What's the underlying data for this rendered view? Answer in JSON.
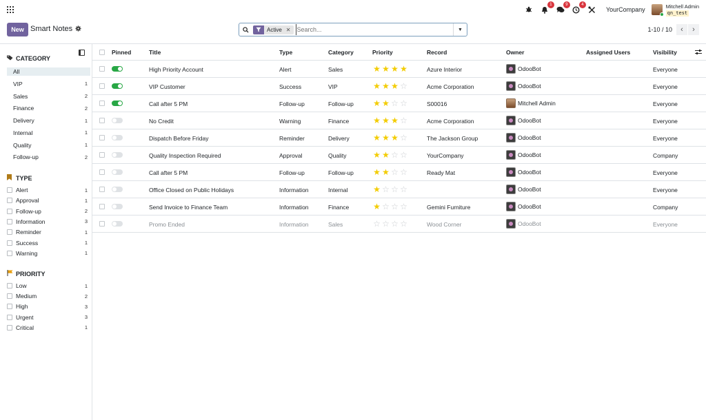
{
  "navbar": {
    "apps_icon": "apps-grid-icon",
    "icons": [
      {
        "name": "bug-icon",
        "glyph": "✹",
        "badge": ""
      },
      {
        "name": "bell-icon",
        "glyph": "🔔",
        "badge": "1"
      },
      {
        "name": "chat-icon",
        "glyph": "💬",
        "badge": "9"
      },
      {
        "name": "activity-clock-icon",
        "glyph": "◷",
        "badge": "4"
      },
      {
        "name": "tools-icon",
        "glyph": "✂",
        "badge": ""
      }
    ],
    "company": "YourCompany",
    "user_name": "Mitchell Admin",
    "db_name": "qn_test"
  },
  "control_panel": {
    "new_label": "New",
    "title": "Smart Notes",
    "search": {
      "facet_value": "Active",
      "placeholder": "Search..."
    },
    "pager": "1-10 / 10"
  },
  "sidebar": {
    "category": {
      "title": "CATEGORY",
      "items": [
        {
          "label": "All",
          "count": ""
        },
        {
          "label": "VIP",
          "count": "1"
        },
        {
          "label": "Sales",
          "count": "2"
        },
        {
          "label": "Finance",
          "count": "2"
        },
        {
          "label": "Delivery",
          "count": "1"
        },
        {
          "label": "Internal",
          "count": "1"
        },
        {
          "label": "Quality",
          "count": "1"
        },
        {
          "label": "Follow-up",
          "count": "2"
        }
      ]
    },
    "type": {
      "title": "TYPE",
      "items": [
        {
          "label": "Alert",
          "count": "1"
        },
        {
          "label": "Approval",
          "count": "1"
        },
        {
          "label": "Follow-up",
          "count": "2"
        },
        {
          "label": "Information",
          "count": "3"
        },
        {
          "label": "Reminder",
          "count": "1"
        },
        {
          "label": "Success",
          "count": "1"
        },
        {
          "label": "Warning",
          "count": "1"
        }
      ]
    },
    "priority": {
      "title": "PRIORITY",
      "items": [
        {
          "label": "Low",
          "count": "1"
        },
        {
          "label": "Medium",
          "count": "2"
        },
        {
          "label": "High",
          "count": "3"
        },
        {
          "label": "Urgent",
          "count": "3"
        },
        {
          "label": "Critical",
          "count": "1"
        }
      ]
    }
  },
  "table": {
    "columns": [
      "Pinned",
      "Title",
      "Type",
      "Category",
      "Priority",
      "Record",
      "Owner",
      "Assigned Users",
      "Visibility"
    ],
    "rows": [
      {
        "pinned": true,
        "title": "High Priority Account",
        "type": "Alert",
        "category": "Sales",
        "stars": 4,
        "record": "Azure Interior",
        "owner": "OdooBot",
        "owner_kind": "bot",
        "visibility": "Everyone",
        "muted": false
      },
      {
        "pinned": true,
        "title": "VIP Customer",
        "type": "Success",
        "category": "VIP",
        "stars": 3,
        "record": "Acme Corporation",
        "owner": "OdooBot",
        "owner_kind": "bot",
        "visibility": "Everyone",
        "muted": false
      },
      {
        "pinned": true,
        "title": "Call after 5 PM",
        "type": "Follow-up",
        "category": "Follow-up",
        "stars": 2,
        "record": "S00016",
        "owner": "Mitchell Admin",
        "owner_kind": "user",
        "visibility": "Everyone",
        "muted": false
      },
      {
        "pinned": false,
        "title": "No Credit",
        "type": "Warning",
        "category": "Finance",
        "stars": 3,
        "record": "Acme Corporation",
        "owner": "OdooBot",
        "owner_kind": "bot",
        "visibility": "Everyone",
        "muted": false
      },
      {
        "pinned": false,
        "title": "Dispatch Before Friday",
        "type": "Reminder",
        "category": "Delivery",
        "stars": 3,
        "record": "The Jackson Group",
        "owner": "OdooBot",
        "owner_kind": "bot",
        "visibility": "Everyone",
        "muted": false
      },
      {
        "pinned": false,
        "title": "Quality Inspection Required",
        "type": "Approval",
        "category": "Quality",
        "stars": 2,
        "record": "YourCompany",
        "owner": "OdooBot",
        "owner_kind": "bot",
        "visibility": "Company",
        "muted": false
      },
      {
        "pinned": false,
        "title": "Call after 5 PM",
        "type": "Follow-up",
        "category": "Follow-up",
        "stars": 2,
        "record": "Ready Mat",
        "owner": "OdooBot",
        "owner_kind": "bot",
        "visibility": "Everyone",
        "muted": false
      },
      {
        "pinned": false,
        "title": "Office Closed on Public Holidays",
        "type": "Information",
        "category": "Internal",
        "stars": 1,
        "record": "",
        "owner": "OdooBot",
        "owner_kind": "bot",
        "visibility": "Everyone",
        "muted": false
      },
      {
        "pinned": false,
        "title": "Send Invoice to Finance Team",
        "type": "Information",
        "category": "Finance",
        "stars": 1,
        "record": "Gemini Furniture",
        "owner": "OdooBot",
        "owner_kind": "bot",
        "visibility": "Company",
        "muted": false
      },
      {
        "pinned": false,
        "title": "Promo Ended",
        "type": "Information",
        "category": "Sales",
        "stars": 0,
        "record": "Wood Corner",
        "owner": "OdooBot",
        "owner_kind": "bot",
        "visibility": "Everyone",
        "muted": true
      }
    ],
    "max_stars": 4
  },
  "colors": {
    "primary": "#71639e",
    "toggle_on": "#28a745",
    "star_on": "#f3cc00",
    "badge": "#d9363e"
  }
}
